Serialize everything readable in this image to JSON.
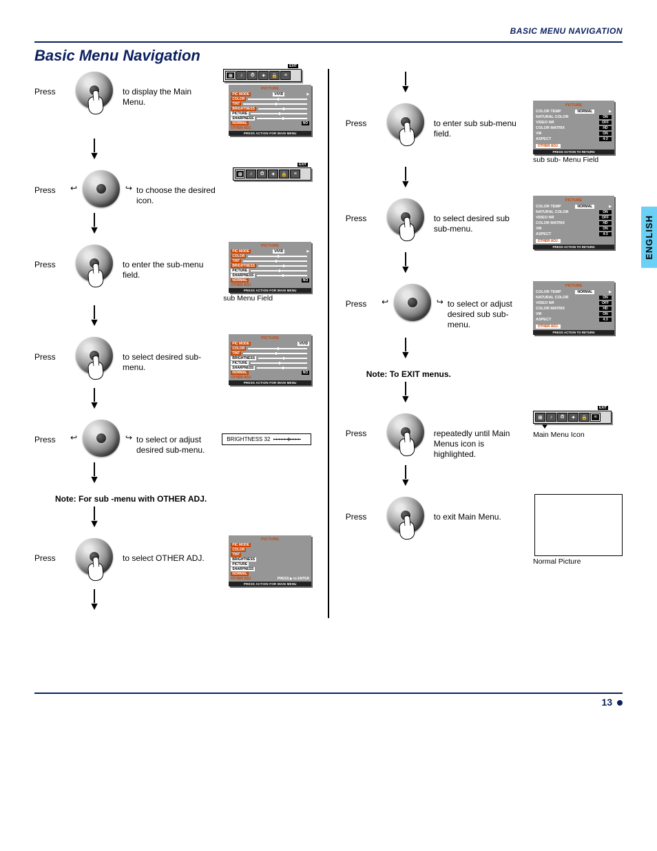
{
  "header": {
    "section": "BASIC MENU NAVIGATION"
  },
  "title": "Basic Menu Navigation",
  "sidebar_tab": "ENGLISH",
  "page_number": "13",
  "labels": {
    "press": "Press",
    "exit_badge": "EXIT",
    "sub_menu_field": "sub Menu Field",
    "sub_sub_menu_field": "sub sub- Menu Field",
    "main_menu_icon": "Main Menu Icon",
    "normal_picture": "Normal Picture",
    "press_enter": "PRESS ▶ to ENTER",
    "press_action_main": "PRESS ACTION FOR MAIN MENU",
    "press_action_return": "PRESS ACTION TO RETURN"
  },
  "notes": {
    "other_adj": "Note: For sub -menu with OTHER ADJ.",
    "exit_menus": "Note: To EXIT menus."
  },
  "left_steps": {
    "s1": "to display the Main Menu.",
    "s2": "to choose the desired icon.",
    "s3": "to enter the sub-menu field.",
    "s4": "to select desired sub-menu.",
    "s5": "to select or adjust desired sub-menu.",
    "s6": "to select OTHER ADJ."
  },
  "right_steps": {
    "s1": "to enter sub sub-menu field.",
    "s2": "to select desired sub sub-menu.",
    "s3": "to select or adjust desired sub sub-menu.",
    "s4": "repeatedly until Main Menus icon is highlighted.",
    "s5": "to exit Main Menu."
  },
  "osd_picture": {
    "header": "PICTURE",
    "items": [
      {
        "label": "PIC MODE",
        "value": "VIVID"
      },
      {
        "label": "COLOR",
        "type": "bar"
      },
      {
        "label": "TINT",
        "type": "bar"
      },
      {
        "label": "BRIGHTNESS",
        "type": "bar"
      },
      {
        "label": "PICTURE",
        "type": "bar"
      },
      {
        "label": "SHARPNESS",
        "type": "bar"
      },
      {
        "label": "NORMAL",
        "value": "NO"
      },
      {
        "label": "OTHER ADJ."
      }
    ],
    "footer": "PRESS ACTION FOR MAIN MENU"
  },
  "osd_other": {
    "header": "PICTURE",
    "items": [
      {
        "label": "COLOR TEMP",
        "value": "NORMAL"
      },
      {
        "label": "NATURAL COLOR",
        "value": "ON"
      },
      {
        "label": "VIDEO NR",
        "value": "OFF"
      },
      {
        "label": "COLOR MATRIX",
        "value": "HD"
      },
      {
        "label": "VM",
        "value": "ON"
      },
      {
        "label": "ASPECT",
        "value": "4:3"
      }
    ],
    "clr": "OTHER ADJ.",
    "footer": "PRESS ACTION TO RETURN"
  },
  "slider": {
    "label": "BRIGHTNESS",
    "value": "32"
  }
}
